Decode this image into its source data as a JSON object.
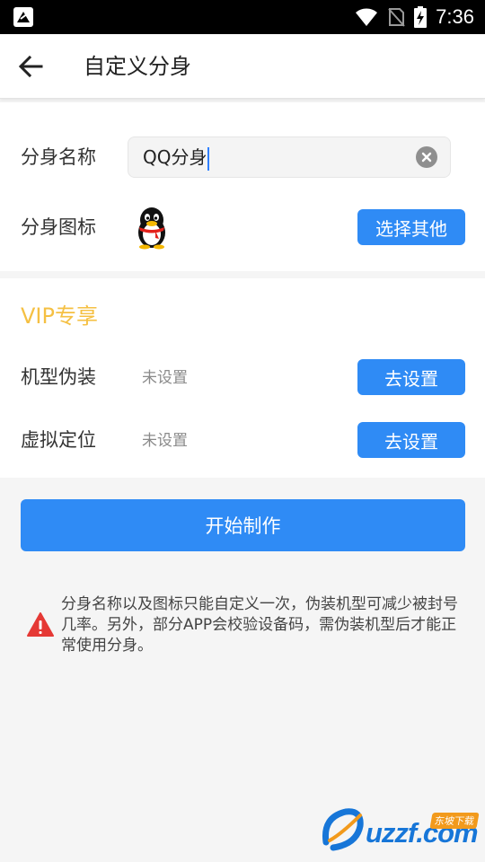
{
  "status_bar": {
    "time": "7:36",
    "icons": [
      "app-notification-icon",
      "wifi-icon",
      "signal-no-sim-icon",
      "battery-charging-icon"
    ]
  },
  "header": {
    "back_icon": "arrow-left-icon",
    "title": "自定义分身"
  },
  "clone_settings": {
    "name_label": "分身名称",
    "name_value": "QQ分身",
    "icon_label": "分身图标",
    "icon_image": "qq-penguin-icon",
    "choose_other_label": "选择其他"
  },
  "vip": {
    "title": "VIP专享",
    "device_label": "机型伪装",
    "device_status": "未设置",
    "device_button": "去设置",
    "location_label": "虚拟定位",
    "location_status": "未设置",
    "location_button": "去设置"
  },
  "start_button": "开始制作",
  "notice": {
    "icon": "warning-icon",
    "text": "分身名称以及图标只能自定义一次，伪装机型可减少被封号几率。另外，部分APP会校验设备码，需伪装机型后才能正常使用分身。"
  },
  "watermark": {
    "text": "uzzf.com",
    "tag": "东坡下载"
  },
  "colors": {
    "accent_blue": "#2f8bf5",
    "vip_gold": "#f5c043",
    "warning_red": "#e53935"
  }
}
